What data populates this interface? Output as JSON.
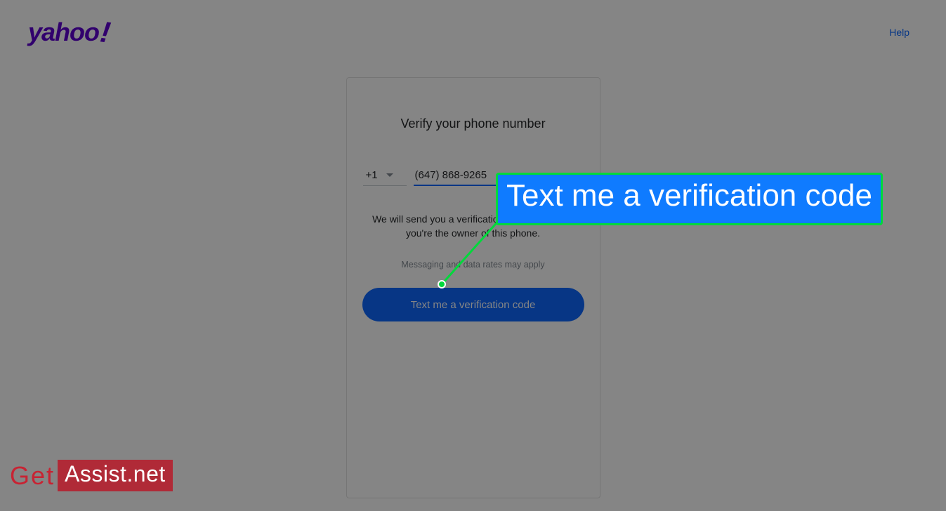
{
  "header": {
    "logo_text": "yahoo",
    "help_label": "Help"
  },
  "card": {
    "title": "Verify your phone number",
    "country_code": "+1",
    "phone_value": "(647) 868-9265",
    "info_text": "We will send you a verification code to confirm you're the owner of this phone.",
    "rates_text": "Messaging and data rates may apply",
    "button_label": "Text me a verification code"
  },
  "annotation": {
    "callout_text": "Text me a verification code"
  },
  "watermark": {
    "left": "Get",
    "right": "Assist.net"
  }
}
